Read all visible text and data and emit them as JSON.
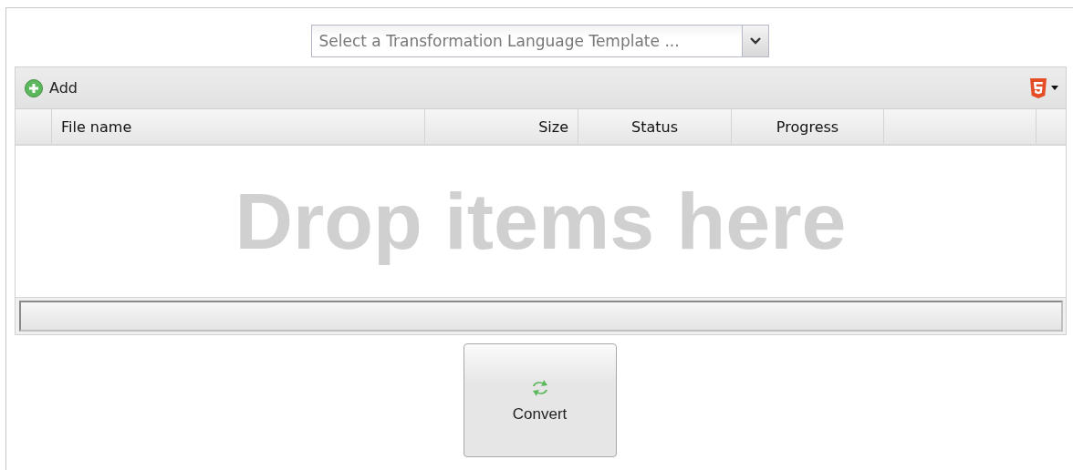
{
  "template_select": {
    "placeholder": "Select a Transformation Language Template ..."
  },
  "toolbar": {
    "add_label": "Add"
  },
  "table": {
    "columns": [
      {
        "label": "File name"
      },
      {
        "label": "Size"
      },
      {
        "label": "Status"
      },
      {
        "label": "Progress"
      }
    ],
    "empty_text": "Drop items here"
  },
  "total_progress": {
    "level": 0
  },
  "convert_button": {
    "label": "Convert"
  }
}
